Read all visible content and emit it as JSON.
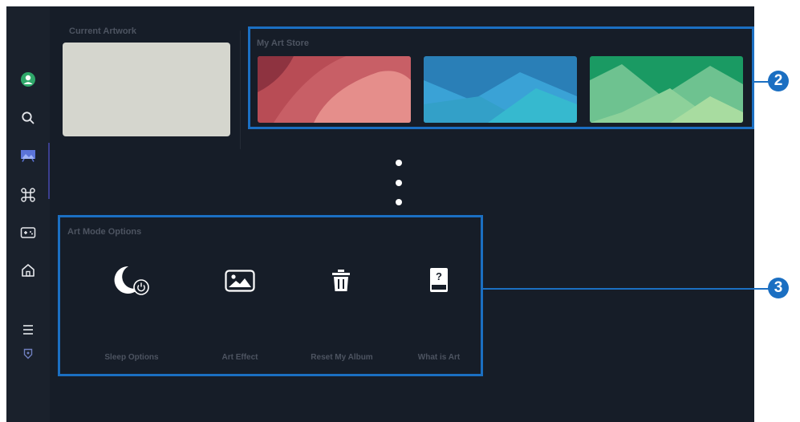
{
  "current_artwork": {
    "label": "Current Artwork"
  },
  "my_art_store": {
    "label": "My Art Store",
    "callout": "2",
    "items": [
      {
        "name": "red-abstract",
        "colors": [
          "#b84c55",
          "#d06b70",
          "#e58e8b"
        ]
      },
      {
        "name": "blue-abstract",
        "colors": [
          "#2a7fb7",
          "#3aa2d6",
          "#36b9cf"
        ]
      },
      {
        "name": "green-abstract",
        "colors": [
          "#1a9a63",
          "#6ec290",
          "#a8dca0"
        ]
      }
    ]
  },
  "art_mode_options": {
    "label": "Art Mode Options",
    "callout": "3",
    "items": [
      {
        "label": "Sleep Options",
        "icon": "sleep-moon-power-icon"
      },
      {
        "label": "Art Effect",
        "icon": "picture-icon"
      },
      {
        "label": "Reset My Album",
        "icon": "trash-icon"
      },
      {
        "label": "What is Art",
        "icon": "help-book-icon"
      }
    ]
  },
  "sidebar": {
    "items": [
      "profile-icon",
      "search-icon",
      "art-icon",
      "apps-icon",
      "game-icon",
      "home-icon",
      "menu-icon",
      "privacy-icon"
    ]
  },
  "colors": {
    "background": "#161d28",
    "highlight": "#1b6fc2",
    "profile": "#2fa86a"
  }
}
